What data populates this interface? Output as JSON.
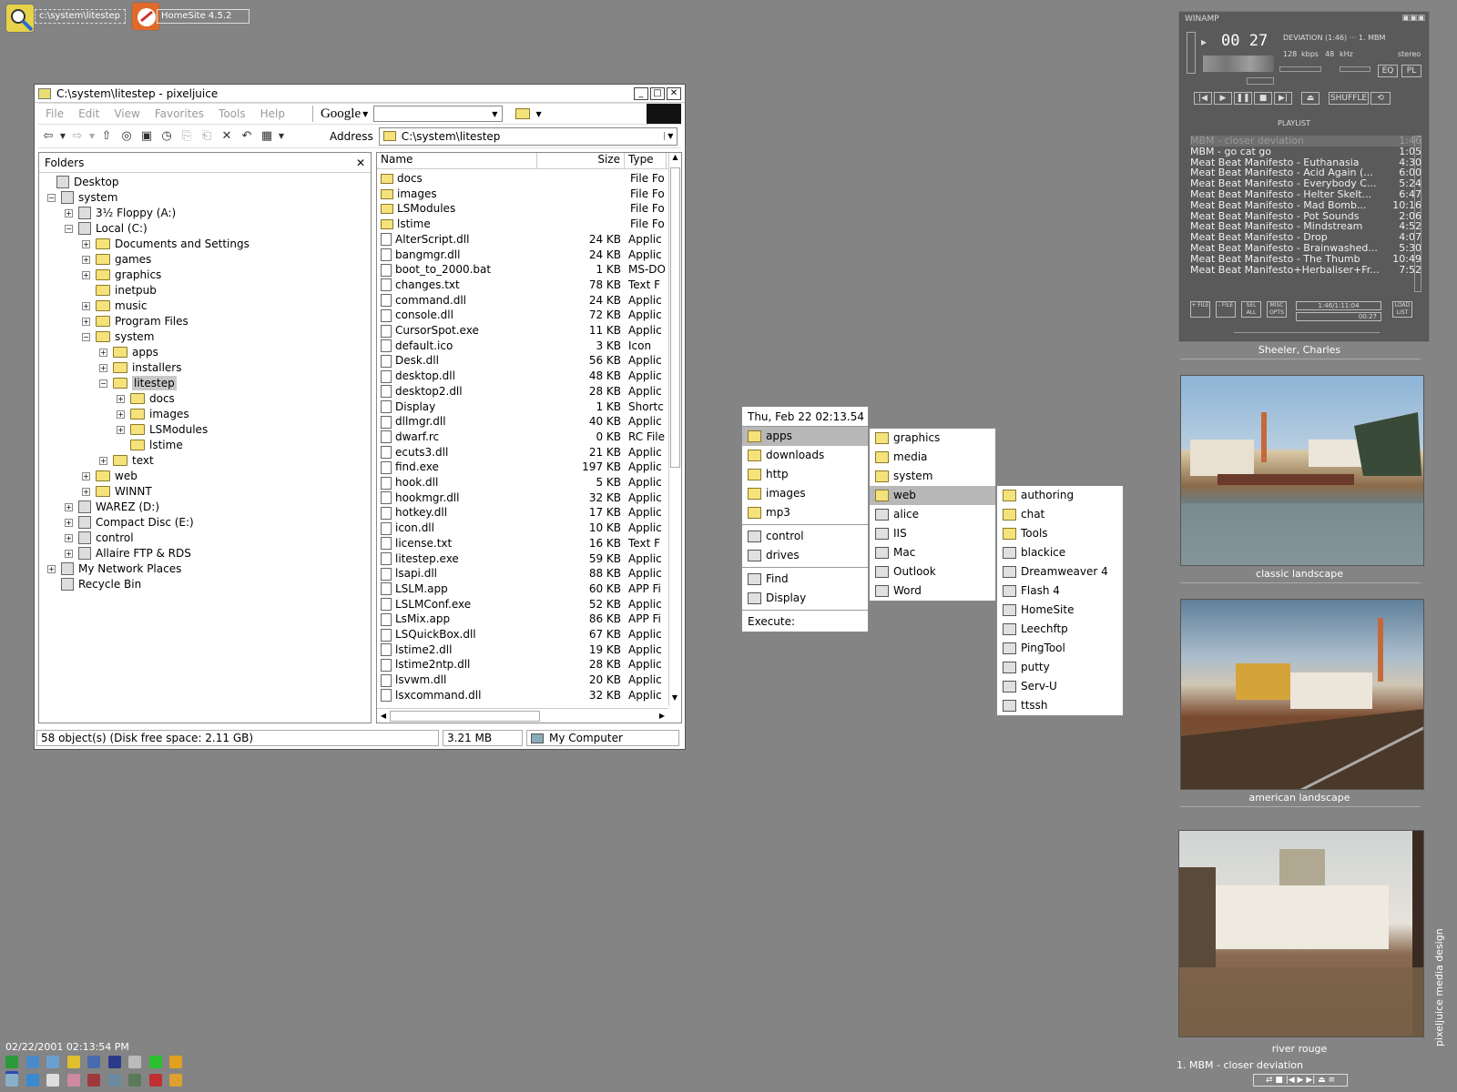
{
  "taskbar": {
    "items": [
      {
        "label": "c:\\system\\litestep",
        "icon": "search-magnifier-icon"
      },
      {
        "label": "HomeSite 4.5.2",
        "icon": "homesite-icon"
      }
    ]
  },
  "explorer": {
    "title": "C:\\system\\litestep - pixeljuice",
    "menu": [
      "File",
      "Edit",
      "View",
      "Favorites",
      "Tools",
      "Help"
    ],
    "google_label": "Google",
    "address_label": "Address",
    "address_value": "C:\\system\\litestep",
    "folders_header": "Folders",
    "close_x": "✕",
    "tree": [
      {
        "label": "Desktop",
        "depth": 0,
        "pm": ""
      },
      {
        "label": "system",
        "depth": 1,
        "pm": "−"
      },
      {
        "label": "3½ Floppy (A:)",
        "depth": 2,
        "pm": "+"
      },
      {
        "label": "Local (C:)",
        "depth": 2,
        "pm": "−"
      },
      {
        "label": "Documents and Settings",
        "depth": 3,
        "pm": "+"
      },
      {
        "label": "games",
        "depth": 3,
        "pm": "+"
      },
      {
        "label": "graphics",
        "depth": 3,
        "pm": "+"
      },
      {
        "label": "inetpub",
        "depth": 3,
        "pm": ""
      },
      {
        "label": "music",
        "depth": 3,
        "pm": "+"
      },
      {
        "label": "Program Files",
        "depth": 3,
        "pm": "+"
      },
      {
        "label": "system",
        "depth": 3,
        "pm": "−"
      },
      {
        "label": "apps",
        "depth": 4,
        "pm": "+"
      },
      {
        "label": "installers",
        "depth": 4,
        "pm": "+"
      },
      {
        "label": "litestep",
        "depth": 4,
        "pm": "−",
        "selected": true
      },
      {
        "label": "docs",
        "depth": 5,
        "pm": "+"
      },
      {
        "label": "images",
        "depth": 5,
        "pm": "+"
      },
      {
        "label": "LSModules",
        "depth": 5,
        "pm": "+"
      },
      {
        "label": "lstime",
        "depth": 5,
        "pm": ""
      },
      {
        "label": "text",
        "depth": 4,
        "pm": "+"
      },
      {
        "label": "web",
        "depth": 3,
        "pm": "+"
      },
      {
        "label": "WINNT",
        "depth": 3,
        "pm": "+"
      },
      {
        "label": "WAREZ (D:)",
        "depth": 2,
        "pm": "+"
      },
      {
        "label": "Compact Disc (E:)",
        "depth": 2,
        "pm": "+"
      },
      {
        "label": "control",
        "depth": 2,
        "pm": "+"
      },
      {
        "label": "Allaire FTP & RDS",
        "depth": 2,
        "pm": "+"
      },
      {
        "label": "My Network Places",
        "depth": 1,
        "pm": "+"
      },
      {
        "label": "Recycle Bin",
        "depth": 1,
        "pm": ""
      }
    ],
    "columns": {
      "name": "Name",
      "size": "Size",
      "type": "Type"
    },
    "files": [
      {
        "name": "docs",
        "size": "",
        "type": "File Fo",
        "folder": true
      },
      {
        "name": "images",
        "size": "",
        "type": "File Fo",
        "folder": true
      },
      {
        "name": "LSModules",
        "size": "",
        "type": "File Fo",
        "folder": true
      },
      {
        "name": "lstime",
        "size": "",
        "type": "File Fo",
        "folder": true
      },
      {
        "name": "AlterScript.dll",
        "size": "24 KB",
        "type": "Applic"
      },
      {
        "name": "bangmgr.dll",
        "size": "24 KB",
        "type": "Applic"
      },
      {
        "name": "boot_to_2000.bat",
        "size": "1 KB",
        "type": "MS-DO"
      },
      {
        "name": "changes.txt",
        "size": "78 KB",
        "type": "Text F"
      },
      {
        "name": "command.dll",
        "size": "24 KB",
        "type": "Applic"
      },
      {
        "name": "console.dll",
        "size": "72 KB",
        "type": "Applic"
      },
      {
        "name": "CursorSpot.exe",
        "size": "11 KB",
        "type": "Applic"
      },
      {
        "name": "default.ico",
        "size": "3 KB",
        "type": "Icon"
      },
      {
        "name": "Desk.dll",
        "size": "56 KB",
        "type": "Applic"
      },
      {
        "name": "desktop.dll",
        "size": "48 KB",
        "type": "Applic"
      },
      {
        "name": "desktop2.dll",
        "size": "28 KB",
        "type": "Applic"
      },
      {
        "name": "Display",
        "size": "1 KB",
        "type": "Shortc"
      },
      {
        "name": "dllmgr.dll",
        "size": "40 KB",
        "type": "Applic"
      },
      {
        "name": "dwarf.rc",
        "size": "0 KB",
        "type": "RC File"
      },
      {
        "name": "ecuts3.dll",
        "size": "21 KB",
        "type": "Applic"
      },
      {
        "name": "find.exe",
        "size": "197 KB",
        "type": "Applic"
      },
      {
        "name": "hook.dll",
        "size": "5 KB",
        "type": "Applic"
      },
      {
        "name": "hookmgr.dll",
        "size": "32 KB",
        "type": "Applic"
      },
      {
        "name": "hotkey.dll",
        "size": "17 KB",
        "type": "Applic"
      },
      {
        "name": "icon.dll",
        "size": "10 KB",
        "type": "Applic"
      },
      {
        "name": "license.txt",
        "size": "16 KB",
        "type": "Text F"
      },
      {
        "name": "litestep.exe",
        "size": "59 KB",
        "type": "Applic"
      },
      {
        "name": "lsapi.dll",
        "size": "88 KB",
        "type": "Applic"
      },
      {
        "name": "LSLM.app",
        "size": "60 KB",
        "type": "APP Fi"
      },
      {
        "name": "LSLMConf.exe",
        "size": "52 KB",
        "type": "Applic"
      },
      {
        "name": "LsMix.app",
        "size": "86 KB",
        "type": "APP Fi"
      },
      {
        "name": "LSQuickBox.dll",
        "size": "67 KB",
        "type": "Applic"
      },
      {
        "name": "lstime2.dll",
        "size": "19 KB",
        "type": "Applic"
      },
      {
        "name": "lstime2ntp.dll",
        "size": "28 KB",
        "type": "Applic"
      },
      {
        "name": "lsvwm.dll",
        "size": "20 KB",
        "type": "Applic"
      },
      {
        "name": "lsxcommand.dll",
        "size": "32 KB",
        "type": "Applic"
      }
    ],
    "status": {
      "objects": "58 object(s) (Disk free space: 2.11 GB)",
      "size": "3.21 MB",
      "zone": "My Computer"
    }
  },
  "popup": {
    "header": "Thu, Feb 22 02:13.54",
    "main": [
      {
        "label": "apps",
        "kind": "folder",
        "highlight": true
      },
      {
        "label": "downloads",
        "kind": "folder"
      },
      {
        "label": "http",
        "kind": "folder"
      },
      {
        "label": "images",
        "kind": "folder"
      },
      {
        "label": "mp3",
        "kind": "folder"
      },
      {
        "sep": true
      },
      {
        "label": "control",
        "kind": "app"
      },
      {
        "label": "drives",
        "kind": "app"
      },
      {
        "sep": true
      },
      {
        "label": "Find",
        "kind": "app"
      },
      {
        "label": "Display",
        "kind": "app"
      },
      {
        "sep": true
      },
      {
        "label": "Execute:",
        "kind": "none"
      }
    ],
    "apps": [
      {
        "label": "graphics",
        "kind": "folder"
      },
      {
        "label": "media",
        "kind": "folder"
      },
      {
        "label": "system",
        "kind": "folder"
      },
      {
        "label": "web",
        "kind": "folder",
        "highlight": true
      },
      {
        "label": "alice",
        "kind": "app"
      },
      {
        "label": "IIS",
        "kind": "app"
      },
      {
        "label": "Mac",
        "kind": "app"
      },
      {
        "label": "Outlook",
        "kind": "app"
      },
      {
        "label": "Word",
        "kind": "app"
      }
    ],
    "web": [
      {
        "label": "authoring",
        "kind": "folder"
      },
      {
        "label": "chat",
        "kind": "folder"
      },
      {
        "label": "Tools",
        "kind": "folder"
      },
      {
        "label": "blackice",
        "kind": "app"
      },
      {
        "label": "Dreamweaver 4",
        "kind": "app"
      },
      {
        "label": "Flash 4",
        "kind": "app"
      },
      {
        "label": "HomeSite",
        "kind": "app"
      },
      {
        "label": "Leechftp",
        "kind": "app"
      },
      {
        "label": "PingTool",
        "kind": "app"
      },
      {
        "label": "putty",
        "kind": "app"
      },
      {
        "label": "Serv-U",
        "kind": "app"
      },
      {
        "label": "ttssh",
        "kind": "app"
      }
    ]
  },
  "winamp": {
    "title": "WINAMP",
    "time": "00 27",
    "track": "DEVIATION (1:46)  ···  1. MBM",
    "kbps": "128",
    "kbps_unit": "kbps",
    "khz": "48",
    "khz_unit": "kHz",
    "stereo": "stereo",
    "eq": "EQ",
    "pl": "PL",
    "shuffle": "SHUFFLE",
    "playlist_label": "PLAYLIST",
    "playlist": [
      {
        "title": "MBM - closer deviation",
        "dur": "1:46",
        "active": true
      },
      {
        "title": "MBM - go cat go",
        "dur": "1:05"
      },
      {
        "title": "Meat Beat Manifesto - Euthanasia",
        "dur": "4:30"
      },
      {
        "title": "Meat Beat Manifesto - Acid Again (...",
        "dur": "6:00"
      },
      {
        "title": "Meat Beat Manifesto - Everybody C...",
        "dur": "5:24"
      },
      {
        "title": "Meat Beat Manifesto - Helter Skelt...",
        "dur": "6:47"
      },
      {
        "title": "Meat Beat Manifesto - Mad Bomb...",
        "dur": "10:16"
      },
      {
        "title": "Meat Beat Manifesto - Pot Sounds",
        "dur": "2:06"
      },
      {
        "title": "Meat Beat Manifesto - Mindstream",
        "dur": "4:52"
      },
      {
        "title": "Meat Beat Manifesto - Drop",
        "dur": "4:07"
      },
      {
        "title": "Meat Beat Manifesto - Brainwashed...",
        "dur": "5:30"
      },
      {
        "title": "Meat Beat Manifesto - The Thumb",
        "dur": "10:49"
      },
      {
        "title": "Meat Beat Manifesto+Herbaliser+Fr...",
        "dur": "7:52"
      }
    ],
    "pl_time": "1:46/1:11:04",
    "pl_pos": "00:27",
    "buttons": {
      "add": "+ FILE",
      "rem": "- FILE",
      "sel": "SEL ALL",
      "misc": "MISC OPTS",
      "list": "LOAD LIST"
    }
  },
  "artist": "Sheeler, Charles",
  "paintings": [
    {
      "caption": "classic landscape"
    },
    {
      "caption": "american landscape"
    },
    {
      "caption": "river rouge"
    }
  ],
  "now_playing": "1. MBM - closer deviation",
  "clock": "02/22/2001 02:13:54 PM",
  "credit": "pixeljuice media design"
}
